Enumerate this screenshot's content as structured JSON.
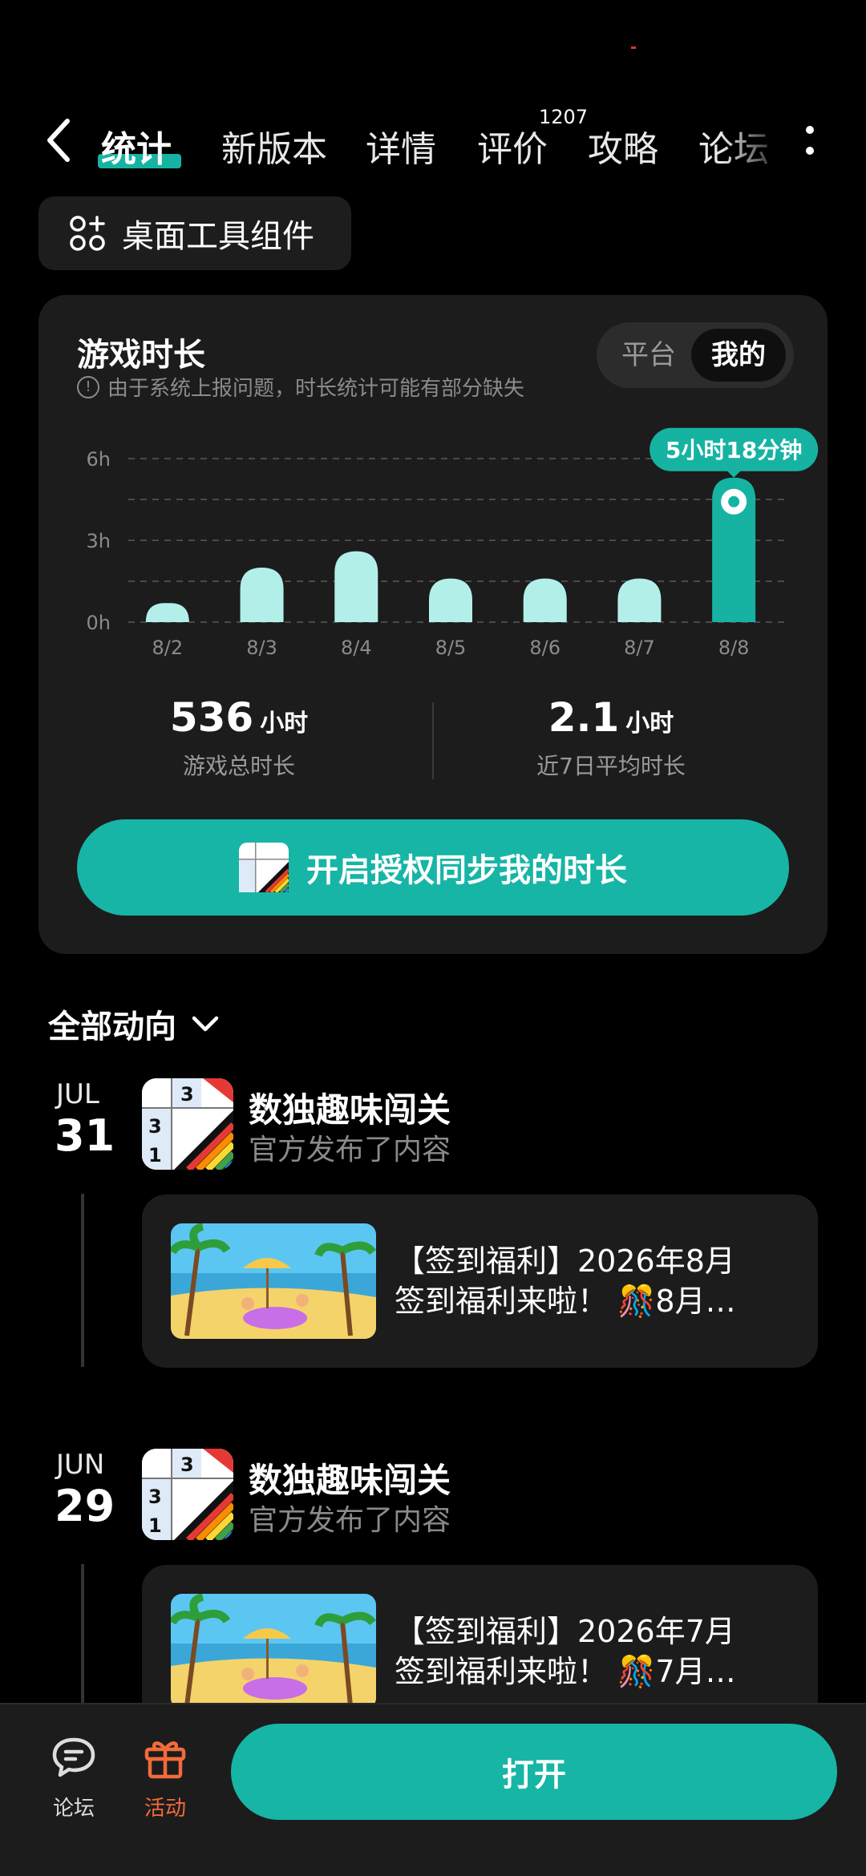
{
  "nav": {
    "tabs": [
      {
        "label": "统计"
      },
      {
        "label": "新版本"
      },
      {
        "label": "详情"
      },
      {
        "label": "评价"
      },
      {
        "label": "攻略"
      },
      {
        "label": "论坛"
      }
    ],
    "review_count": "1207"
  },
  "widget_button": {
    "label": "桌面工具组件"
  },
  "playtime": {
    "title": "游戏时长",
    "note": "由于系统上报问题，时长统计可能有部分缺失",
    "toggle": {
      "options": [
        "平台",
        "我的"
      ],
      "selected": "我的"
    },
    "total_hours": "536",
    "total_unit": "小时",
    "total_label": "游戏总时长",
    "avg_hours": "2.1",
    "avg_unit": "小时",
    "avg_label": "近7日平均时长",
    "sync_button": "开启授权同步我的时长"
  },
  "chart_data": {
    "type": "bar",
    "categories": [
      "8/2",
      "8/3",
      "8/4",
      "8/5",
      "8/6",
      "8/7",
      "8/8"
    ],
    "values": [
      0.7,
      2.0,
      2.6,
      1.6,
      1.6,
      1.6,
      5.3
    ],
    "y_ticks": [
      "0h",
      "3h",
      "6h"
    ],
    "ylim": [
      0,
      6
    ],
    "grid": true,
    "highlight_index": 6,
    "highlight_label": "5小时18分钟",
    "colors": {
      "bar": "#b3efe9",
      "highlight": "#16b3a3"
    }
  },
  "feed": {
    "filter_label": "全部动向",
    "entries": [
      {
        "month": "JUL",
        "day": "31",
        "app_name": "数独趣味闯关",
        "app_sub": "官方发布了内容",
        "post_line1": "【签到福利】2026年8月",
        "post_line2": "签到福利来啦！ 🎊8月…"
      },
      {
        "month": "JUN",
        "day": "29",
        "app_name": "数独趣味闯关",
        "app_sub": "官方发布了内容",
        "post_line1": "【签到福利】2026年7月",
        "post_line2": "签到福利来啦！ 🎊7月…"
      }
    ]
  },
  "bottom": {
    "forum_label": "论坛",
    "activity_label": "活动",
    "open_button": "打开"
  },
  "colors": {
    "accent": "#17b5a6",
    "activity": "#f26b3a",
    "bg": "#000000",
    "card": "#1c1c1c"
  }
}
